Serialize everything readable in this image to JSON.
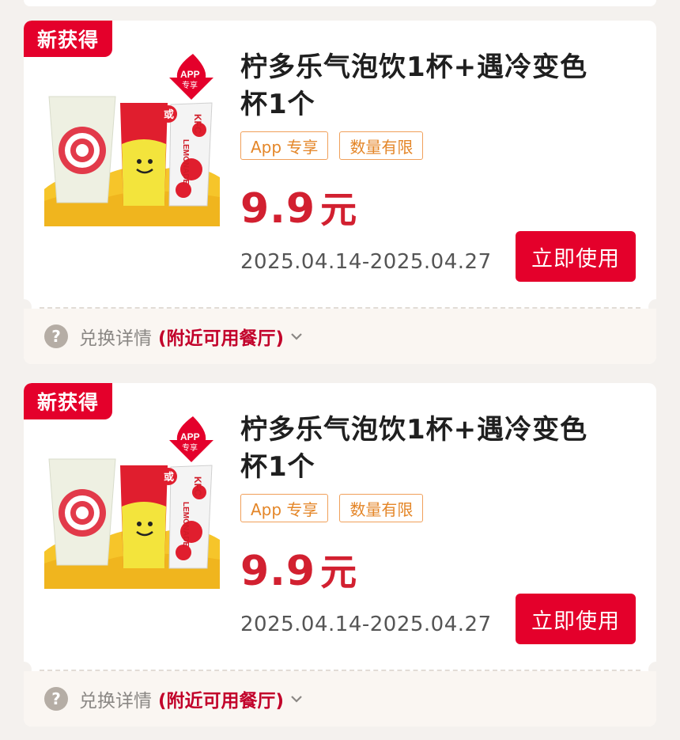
{
  "coupons": [
    {
      "tag": "新获得",
      "title": "柠多乐气泡饮1杯+遇冷变色杯1个",
      "badges": [
        "App 专享",
        "数量有限"
      ],
      "price": "9.9",
      "price_unit": "元",
      "date_range": "2025.04.14-2025.04.27",
      "use_button": "立即使用",
      "footer_label": "兑换详情",
      "footer_link": "(附近可用餐厅)",
      "image_text": {
        "app_badge": "APP",
        "app_badge_sub": "专享",
        "or": "或",
        "can_brand": "KFC",
        "can_text": "LEMONADE"
      }
    },
    {
      "tag": "新获得",
      "title": "柠多乐气泡饮1杯+遇冷变色杯1个",
      "badges": [
        "App 专享",
        "数量有限"
      ],
      "price": "9.9",
      "price_unit": "元",
      "date_range": "2025.04.14-2025.04.27",
      "use_button": "立即使用",
      "footer_label": "兑换详情",
      "footer_link": "(附近可用餐厅)",
      "image_text": {
        "app_badge": "APP",
        "app_badge_sub": "专享",
        "or": "或",
        "can_brand": "KFC",
        "can_text": "LEMONADE"
      }
    }
  ],
  "colors": {
    "brand_red": "#e4002b",
    "price_red": "#d22030",
    "badge_orange": "#e48628"
  },
  "icons": {
    "help": "question-circle-icon",
    "expand": "chevron-down-icon"
  }
}
